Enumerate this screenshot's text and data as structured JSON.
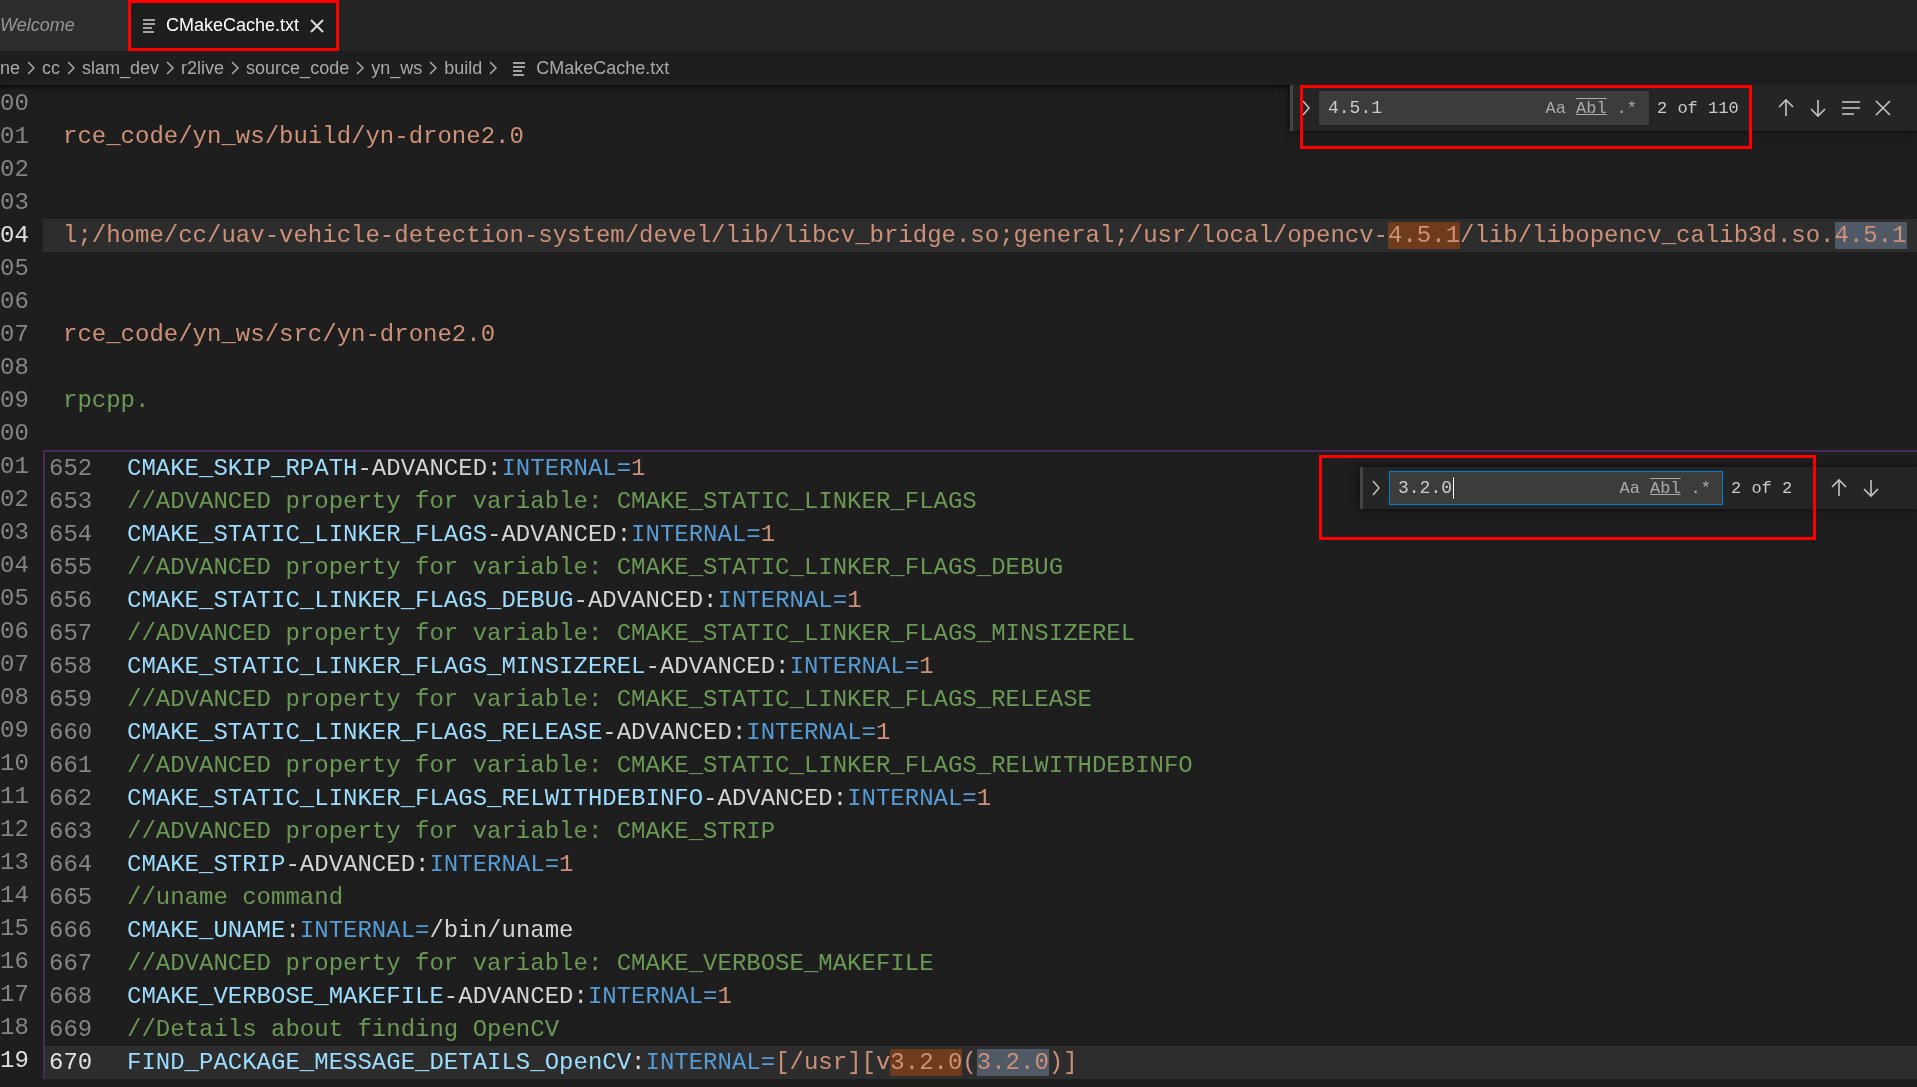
{
  "tabs": [
    {
      "label": "Welcome",
      "selected": false,
      "preview": true,
      "annotated": false
    },
    {
      "label": "CMakeCache.txt",
      "selected": true,
      "preview": false,
      "annotated": true
    }
  ],
  "breadcrumbs": [
    {
      "label": "ne",
      "kind": "folder"
    },
    {
      "label": "cc",
      "kind": "folder"
    },
    {
      "label": "slam_dev",
      "kind": "folder"
    },
    {
      "label": "r2live",
      "kind": "folder"
    },
    {
      "label": "source_code",
      "kind": "folder"
    },
    {
      "label": "yn_ws",
      "kind": "folder"
    },
    {
      "label": "build",
      "kind": "folder"
    },
    {
      "label": "CMakeCache.txt",
      "kind": "file"
    }
  ],
  "editor": {
    "rows": [
      {
        "number": "00",
        "current": false
      },
      {
        "number": "01",
        "current": false,
        "tokens": [
          {
            "text": "rce_code/yn_ws/build/yn-drone2.0",
            "kind": "string"
          }
        ]
      },
      {
        "number": "02",
        "current": false
      },
      {
        "number": "03",
        "current": false
      },
      {
        "number": "04",
        "current": true,
        "tokens": [
          {
            "text": "l;/home/cc/uav-vehicle-detection-system/devel/lib/libcv_bridge.so;general;/usr/local/opencv-",
            "kind": "string"
          },
          {
            "text": "4.5.1",
            "kind": "string",
            "match": true,
            "active": true
          },
          {
            "text": "/lib/libopencv_calib3d.so.",
            "kind": "string"
          },
          {
            "text": "4.5.1",
            "kind": "string",
            "match": true,
            "active": false
          }
        ]
      },
      {
        "number": "05",
        "current": false
      },
      {
        "number": "06",
        "current": false
      },
      {
        "number": "07",
        "current": false,
        "tokens": [
          {
            "text": "rce_code/yn_ws/src/yn-drone2.0",
            "kind": "string"
          }
        ]
      },
      {
        "number": "08",
        "current": false
      },
      {
        "number": "09",
        "current": false,
        "tokens": [
          {
            "text": "rpcpp.",
            "kind": "comment"
          }
        ]
      },
      {
        "number": "00",
        "current": false
      }
    ],
    "find": {
      "query": "4.5.1",
      "focused": false,
      "options": [
        "Aa",
        "Abl",
        ".*"
      ],
      "result": "2 of 110",
      "actions": [
        {
          "kind": "previous"
        },
        {
          "kind": "next"
        },
        {
          "kind": "in-selection"
        },
        {
          "kind": "close"
        }
      ],
      "annotated": true
    },
    "peek": {
      "rows": [
        {
          "outer": "01",
          "number": "652",
          "current": false,
          "tokens": [
            {
              "text": "CMAKE_SKIP_RPATH",
              "kind": "key"
            },
            {
              "text": "-ADVANCED:",
              "kind": "plain"
            },
            {
              "text": "INTERNAL=",
              "kind": "type"
            },
            {
              "text": "1",
              "kind": "string"
            }
          ]
        },
        {
          "outer": "02",
          "number": "653",
          "current": false,
          "tokens": [
            {
              "text": "//ADVANCED property for variable: CMAKE_STATIC_LINKER_FLAGS",
              "kind": "comment"
            }
          ]
        },
        {
          "outer": "03",
          "number": "654",
          "current": false,
          "tokens": [
            {
              "text": "CMAKE_STATIC_LINKER_FLAGS",
              "kind": "key"
            },
            {
              "text": "-ADVANCED:",
              "kind": "plain"
            },
            {
              "text": "INTERNAL=",
              "kind": "type"
            },
            {
              "text": "1",
              "kind": "string"
            }
          ]
        },
        {
          "outer": "04",
          "number": "655",
          "current": false,
          "tokens": [
            {
              "text": "//ADVANCED property for variable: CMAKE_STATIC_LINKER_FLAGS_DEBUG",
              "kind": "comment"
            }
          ]
        },
        {
          "outer": "05",
          "number": "656",
          "current": false,
          "tokens": [
            {
              "text": "CMAKE_STATIC_LINKER_FLAGS_DEBUG",
              "kind": "key"
            },
            {
              "text": "-ADVANCED:",
              "kind": "plain"
            },
            {
              "text": "INTERNAL=",
              "kind": "type"
            },
            {
              "text": "1",
              "kind": "string"
            }
          ]
        },
        {
          "outer": "06",
          "number": "657",
          "current": false,
          "tokens": [
            {
              "text": "//ADVANCED property for variable: CMAKE_STATIC_LINKER_FLAGS_MINSIZEREL",
              "kind": "comment"
            }
          ]
        },
        {
          "outer": "07",
          "number": "658",
          "current": false,
          "tokens": [
            {
              "text": "CMAKE_STATIC_LINKER_FLAGS_MINSIZEREL",
              "kind": "key"
            },
            {
              "text": "-ADVANCED:",
              "kind": "plain"
            },
            {
              "text": "INTERNAL=",
              "kind": "type"
            },
            {
              "text": "1",
              "kind": "string"
            }
          ]
        },
        {
          "outer": "08",
          "number": "659",
          "current": false,
          "tokens": [
            {
              "text": "//ADVANCED property for variable: CMAKE_STATIC_LINKER_FLAGS_RELEASE",
              "kind": "comment"
            }
          ]
        },
        {
          "outer": "09",
          "number": "660",
          "current": false,
          "tokens": [
            {
              "text": "CMAKE_STATIC_LINKER_FLAGS_RELEASE",
              "kind": "key"
            },
            {
              "text": "-ADVANCED:",
              "kind": "plain"
            },
            {
              "text": "INTERNAL=",
              "kind": "type"
            },
            {
              "text": "1",
              "kind": "string"
            }
          ]
        },
        {
          "outer": "10",
          "number": "661",
          "current": false,
          "tokens": [
            {
              "text": "//ADVANCED property for variable: CMAKE_STATIC_LINKER_FLAGS_RELWITHDEBINFO",
              "kind": "comment"
            }
          ]
        },
        {
          "outer": "11",
          "number": "662",
          "current": false,
          "tokens": [
            {
              "text": "CMAKE_STATIC_LINKER_FLAGS_RELWITHDEBINFO",
              "kind": "key"
            },
            {
              "text": "-ADVANCED:",
              "kind": "plain"
            },
            {
              "text": "INTERNAL=",
              "kind": "type"
            },
            {
              "text": "1",
              "kind": "string"
            }
          ]
        },
        {
          "outer": "12",
          "number": "663",
          "current": false,
          "tokens": [
            {
              "text": "//ADVANCED property for variable: CMAKE_STRIP",
              "kind": "comment"
            }
          ]
        },
        {
          "outer": "13",
          "number": "664",
          "current": false,
          "tokens": [
            {
              "text": "CMAKE_STRIP",
              "kind": "key"
            },
            {
              "text": "-ADVANCED:",
              "kind": "plain"
            },
            {
              "text": "INTERNAL=",
              "kind": "type"
            },
            {
              "text": "1",
              "kind": "string"
            }
          ]
        },
        {
          "outer": "14",
          "number": "665",
          "current": false,
          "tokens": [
            {
              "text": "//uname command",
              "kind": "comment"
            }
          ]
        },
        {
          "outer": "15",
          "number": "666",
          "current": false,
          "tokens": [
            {
              "text": "CMAKE_UNAME",
              "kind": "key"
            },
            {
              "text": ":",
              "kind": "plain"
            },
            {
              "text": "INTERNAL=",
              "kind": "type"
            },
            {
              "text": "/bin/uname",
              "kind": "plain"
            }
          ]
        },
        {
          "outer": "16",
          "number": "667",
          "current": false,
          "tokens": [
            {
              "text": "//ADVANCED property for variable: CMAKE_VERBOSE_MAKEFILE",
              "kind": "comment"
            }
          ]
        },
        {
          "outer": "17",
          "number": "668",
          "current": false,
          "tokens": [
            {
              "text": "CMAKE_VERBOSE_MAKEFILE",
              "kind": "key"
            },
            {
              "text": "-ADVANCED:",
              "kind": "plain"
            },
            {
              "text": "INTERNAL=",
              "kind": "type"
            },
            {
              "text": "1",
              "kind": "string"
            }
          ]
        },
        {
          "outer": "18",
          "number": "669",
          "current": false,
          "tokens": [
            {
              "text": "//Details about finding OpenCV",
              "kind": "comment"
            }
          ]
        },
        {
          "outer": "19",
          "number": "670",
          "current": true,
          "tokens": [
            {
              "text": "FIND_PACKAGE_MESSAGE_DETAILS_OpenCV",
              "kind": "key"
            },
            {
              "text": ":",
              "kind": "plain"
            },
            {
              "text": "INTERNAL=",
              "kind": "type"
            },
            {
              "text": "[/usr][v",
              "kind": "string"
            },
            {
              "text": "3.2.0",
              "kind": "string",
              "match": true,
              "active": true
            },
            {
              "text": "(",
              "kind": "string"
            },
            {
              "text": "3.2.0",
              "kind": "string",
              "match": true,
              "active": false
            },
            {
              "text": ")]",
              "kind": "string"
            }
          ]
        }
      ],
      "find": {
        "query": "3.2.0",
        "focused": true,
        "options": [
          "Aa",
          "Abl",
          ".*"
        ],
        "result": "2 of 2",
        "actions": [
          {
            "kind": "previous"
          },
          {
            "kind": "next"
          }
        ],
        "annotated": true
      }
    }
  }
}
